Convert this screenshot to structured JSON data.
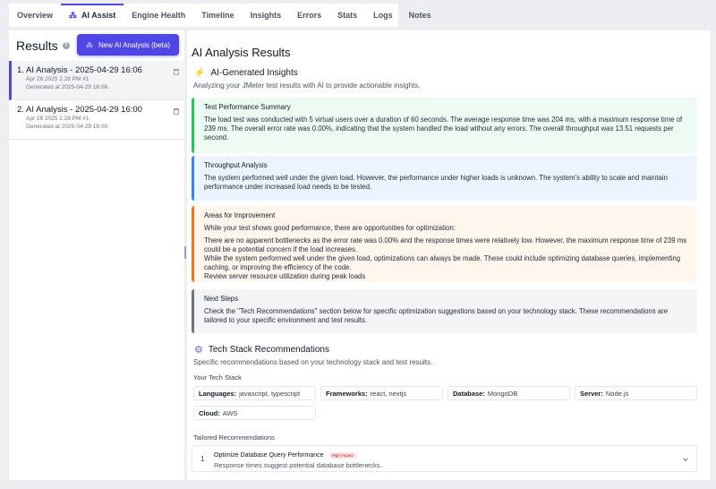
{
  "tabs": [
    {
      "label": "Overview"
    },
    {
      "label": "AI Assist"
    },
    {
      "label": "Engine Health"
    },
    {
      "label": "Timeline"
    },
    {
      "label": "Insights"
    },
    {
      "label": "Errors"
    },
    {
      "label": "Stats"
    },
    {
      "label": "Logs"
    },
    {
      "label": "Notes"
    }
  ],
  "sidebar": {
    "title": "Results",
    "help_icon": "?",
    "new_button": "New AI Analysis (beta)",
    "runs": [
      {
        "title": "1. AI Analysis - 2025-04-29 16:06",
        "meta": "Apr 28 2025 2.28 PM #1",
        "generated": "Generated at 2025-04-29 16:06."
      },
      {
        "title": "2. AI Analysis - 2025-04-29 16:00",
        "meta": "Apr 28 2025 2.28 PM #1",
        "generated": "Generated at 2025-04-29 16:00."
      }
    ]
  },
  "main": {
    "title": "AI Analysis Results",
    "insights": {
      "heading": "AI-Generated Insights",
      "subtitle": "Analyzing your JMeter test results with AI to provide actionable insights.",
      "cards": [
        {
          "title": "Test Performance Summary",
          "body": "The load test was conducted with 5 virtual users over a duration of 60 seconds. The average response time was 204 ms, with a maximum response time of 239 ms. The overall error rate was 0.00%, indicating that the system handled the load without any errors. The overall throughput was 13.51 requests per second."
        },
        {
          "title": "Throughput Analysis",
          "body": "The system performed well under the given load. However, the performance under higher loads is unknown. The system's ability to scale and maintain performance under increased load needs to be tested."
        },
        {
          "title": "Areas for Improvement",
          "intro": "While your test shows good performance, there are opportunities for optimization:",
          "lines": [
            "There are no apparent bottlenecks as the error rate was 0.00% and the response times were relatively low. However, the maximum response time of 239 ms could be a potential concern if the load increases.",
            "While the system performed well under the given load, optimizations can always be made. These could include optimizing database queries, implementing caching, or improving the efficiency of the code.",
            "Review server resource utilization during peak loads"
          ]
        },
        {
          "title": "Next Steps",
          "body": "Check the \"Tech Recommendations\" section below for specific optimization suggestions based on your technology stack. These recommendations are tailored to your specific environment and test results."
        }
      ]
    },
    "tech": {
      "heading": "Tech Stack Recommendations",
      "subtitle": "Specific recommendations based on your technology stack and test results.",
      "stack_label": "Your Tech Stack",
      "chips": [
        {
          "key": "Languages:",
          "value": "javascript, typescript"
        },
        {
          "key": "Frameworks:",
          "value": "react, nextjs"
        },
        {
          "key": "Database:",
          "value": "MongoDB"
        },
        {
          "key": "Server:",
          "value": "Node.js"
        },
        {
          "key": "Cloud:",
          "value": "AWS"
        }
      ],
      "tailored_label": "Tailored Recommendations",
      "recommendations": [
        {
          "num": "1",
          "title": "Optimize Database Query Performance",
          "badge": "High Impact",
          "desc": "Response times suggest potential database bottlenecks."
        }
      ]
    }
  },
  "colors": {
    "accent": "#4f46e5",
    "green": "#22c55e",
    "blue": "#3b82f6",
    "orange": "#f97316",
    "gray": "#6b7280"
  },
  "icons": {
    "ai_tab": "sparkle-icon",
    "insights": "bolt-icon",
    "tech": "gear-icon",
    "run_delete": "trash-icon",
    "rec_expand": "chevron-down-icon"
  }
}
